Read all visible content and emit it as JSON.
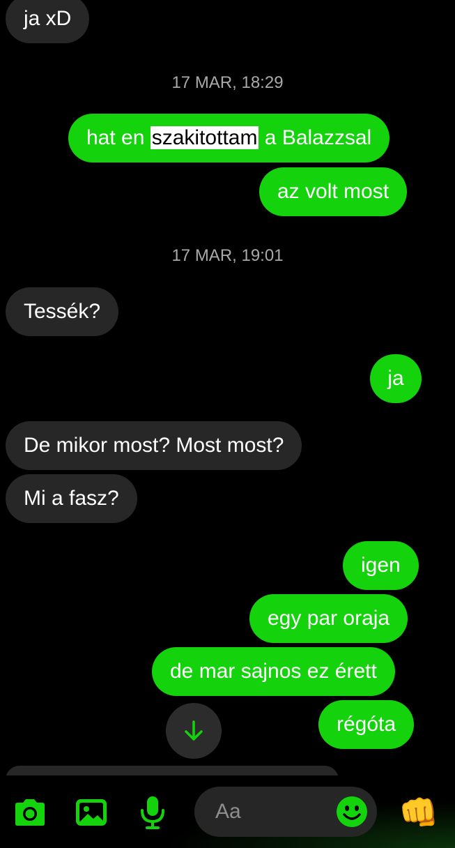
{
  "messages": [
    {
      "side": "in",
      "text": "ja xD"
    },
    {
      "side": "ts",
      "text": "17 MAR, 18:29"
    },
    {
      "side": "out",
      "pre": "hat en ",
      "highlight": "szakitottam",
      "post": " a Balazzsal"
    },
    {
      "side": "out",
      "text": "az volt most"
    },
    {
      "side": "ts",
      "text": "17 MAR, 19:01"
    },
    {
      "side": "in",
      "text": "Tessék?"
    },
    {
      "side": "out",
      "text": "ja"
    },
    {
      "side": "in",
      "text": "De mikor most? Most most?"
    },
    {
      "side": "in",
      "text": "Mi a fasz?"
    },
    {
      "side": "out",
      "text": "igen"
    },
    {
      "side": "out",
      "text": "egy par oraja"
    },
    {
      "side": "out",
      "text": "de mar sajnos ez érett"
    },
    {
      "side": "out",
      "text": "régóta"
    }
  ],
  "composer": {
    "placeholder": "Aa"
  },
  "icons": {
    "scroll": "arrow-down-icon",
    "camera": "camera-icon",
    "gallery": "image-icon",
    "mic": "microphone-icon",
    "emoji": "smiley-icon",
    "react": "fist-emoji"
  },
  "colors": {
    "accent": "#14d30d",
    "incoming": "#272727",
    "background": "#000000",
    "timestamp": "#a9a9a9"
  },
  "reaction_emoji": "👊"
}
